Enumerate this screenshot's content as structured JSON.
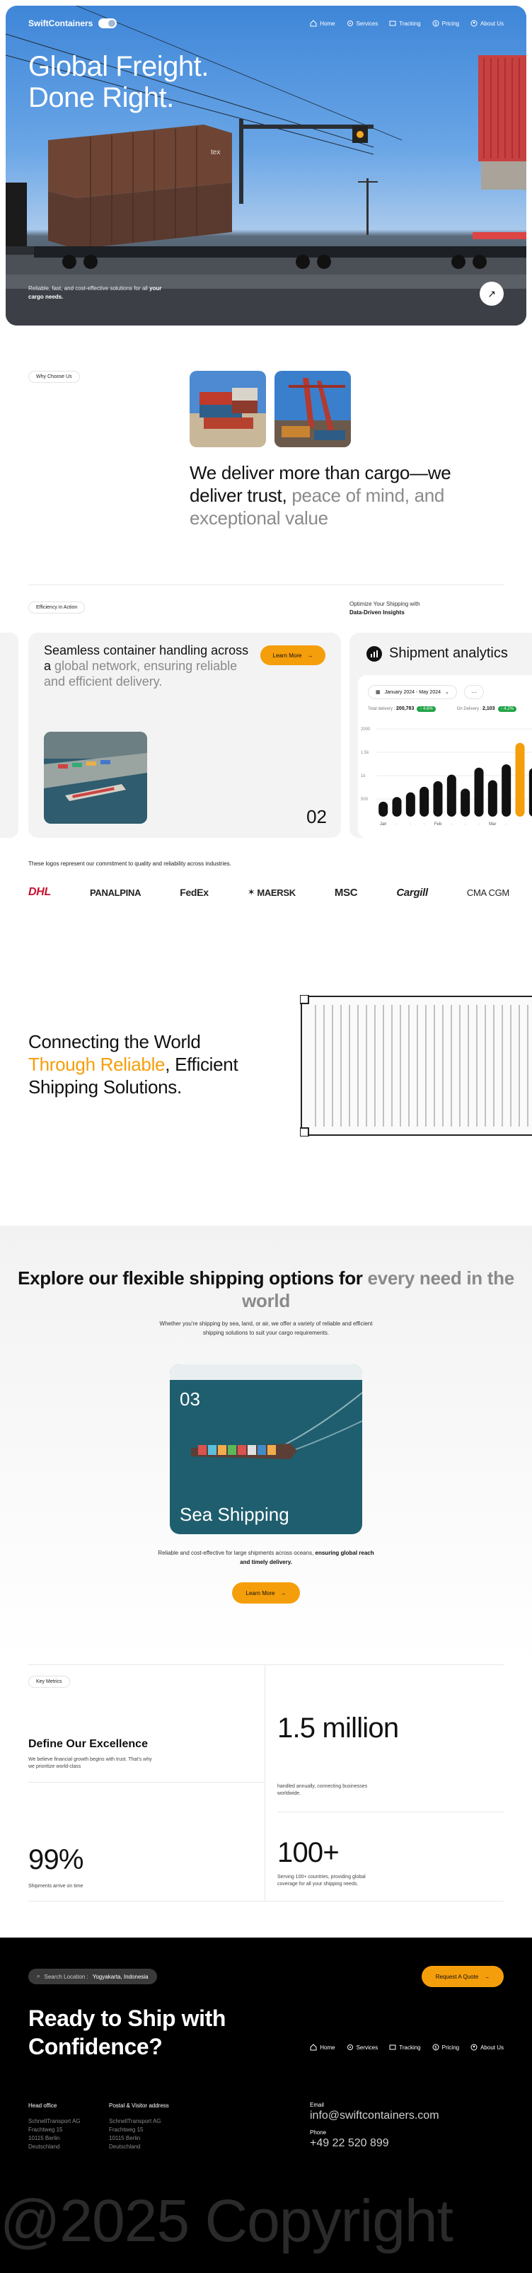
{
  "header": {
    "brand": "SwiftContainers",
    "nav": [
      {
        "label": "Home",
        "icon": "home-icon"
      },
      {
        "label": "Services",
        "icon": "services-icon"
      },
      {
        "label": "Tracking",
        "icon": "tracking-icon"
      },
      {
        "label": "Pricing",
        "icon": "pricing-icon"
      },
      {
        "label": "About Us",
        "icon": "about-icon"
      }
    ]
  },
  "hero": {
    "title": "Global Freight. Done Right.",
    "subtitle_pre": "Reliable, fast, and cost-effective solutions for all ",
    "subtitle_bold": "your cargo needs."
  },
  "why": {
    "pill": "Why Choose Us",
    "text_dark": "We deliver more than cargo—we deliver trust,",
    "text_muted": " peace of mind, and exceptional value"
  },
  "efficiency": {
    "pill": "Efficiency in Action",
    "optimize_line1": "Optimize Your Shipping with",
    "optimize_line2": "Data-Driven Insights",
    "card_title_dark": "Seamless container handling across a",
    "card_title_muted": " global network, ensuring reliable and efficient delivery.",
    "learn_more": "Learn More",
    "card_number": "02"
  },
  "analytics": {
    "title": "Shipment analytics",
    "date_range": "January 2024 - May 2024",
    "more": "···",
    "total_label": "Total delivery :",
    "total_value": "200,783",
    "total_badge": "↑ 4.6%",
    "ontime_label": "On Delivery :",
    "ontime_value": "2,103",
    "ontime_badge": "↑ 4.2%"
  },
  "chart_data": {
    "type": "bar",
    "categories": [
      "Jan",
      "",
      "",
      "",
      "Feb",
      "",
      "",
      "",
      "Mar",
      "",
      "",
      ""
    ],
    "values": [
      320,
      420,
      520,
      640,
      760,
      900,
      600,
      1050,
      780,
      1120,
      1580,
      1040
    ],
    "highlight_index": 10,
    "y_ticks": [
      "2000",
      "1.5k",
      "1k",
      "500"
    ],
    "ylim": [
      0,
      2000
    ],
    "colors": {
      "bar": "#111111",
      "highlight": "#f59e0b"
    }
  },
  "logos": {
    "caption": "These logos represent our commitment to quality and reliability across industries.",
    "items": [
      "DHL",
      "PANALPINA",
      "FedEx",
      "MAERSK",
      "MSC",
      "Cargill",
      "CMA CGM"
    ]
  },
  "connect": {
    "line1": "Connecting the World ",
    "orange": "Through Reliable",
    "line2": ", Efficient Shipping Solutions."
  },
  "explore": {
    "title_dark": "Explore our flexible shipping options for",
    "title_muted": " every need in the world",
    "subtitle": "Whether you're shipping by sea, land, or air, we offer a variety of reliable and efficient shipping solutions to suit your cargo requirements.",
    "card_number": "03",
    "card_label": "Sea Shipping",
    "desc_pre": "Reliable and cost-effective for large shipments across oceans, ",
    "desc_bold": "ensuring global reach and timely delivery.",
    "learn_more": "Learn More"
  },
  "metrics": {
    "pill": "Key Metrics",
    "title": "Define Our Excellence",
    "desc": "We believe financial growth begins with trust. That's why we prioritize world-class",
    "big1": "1.5 million",
    "small1": "handled annually, connecting businesses worldwide.",
    "big2": "99%",
    "small2": "Shipments arrive on time",
    "big3": "100+",
    "small3": "Serving 100+ countries, providing global coverage for all your shipping needs."
  },
  "footer": {
    "location_label": "Search Location :",
    "location_value": "Yogyakarta, Indonesia",
    "quote_button": "Request A Quote",
    "ready": "Ready to Ship with Confidence?",
    "head_office": {
      "title": "Head office",
      "lines": [
        "SchnellTransport AG",
        "Frachtweg 15",
        "10115 Berlin",
        "Deutschland"
      ]
    },
    "postal": {
      "title": "Postal & Visitor address",
      "lines": [
        "SchnellTransport AG",
        "Frachtweg 15",
        "10115 Berlin",
        "Deutschland"
      ]
    },
    "email_label": "Email",
    "email": "info@swiftcontainers.com",
    "phone_label": "Phone",
    "phone": "+49 22 520 899",
    "copyright": "@2025 Copyright"
  }
}
